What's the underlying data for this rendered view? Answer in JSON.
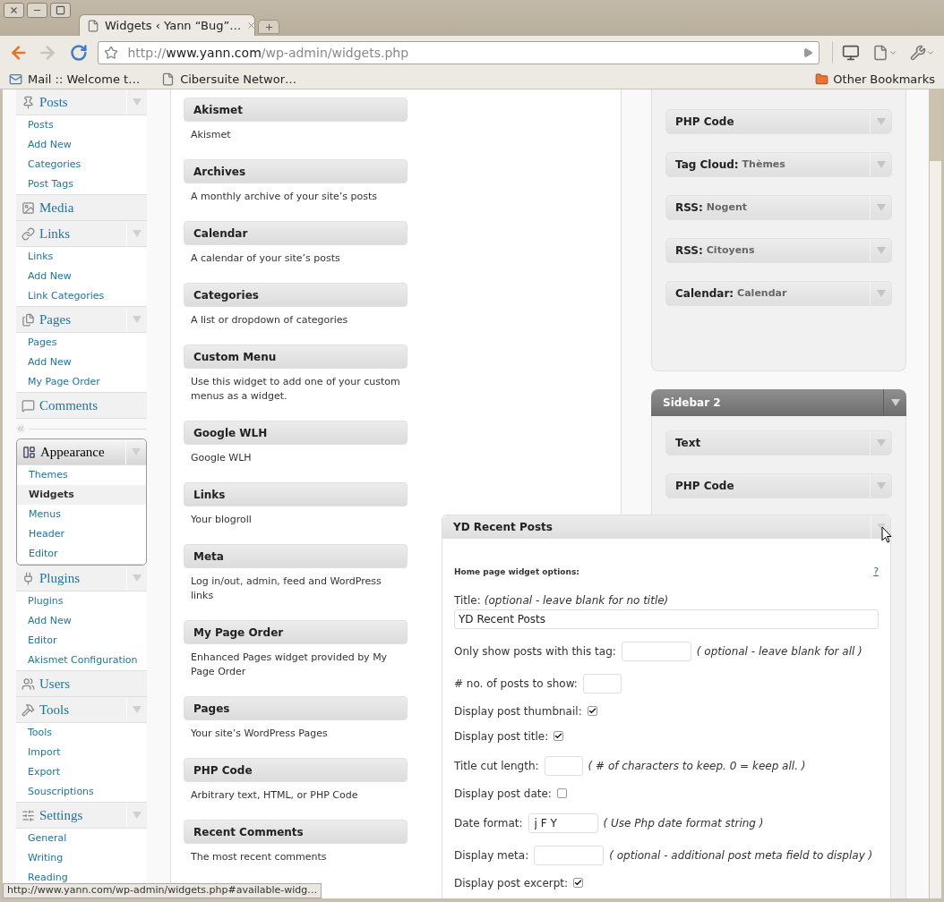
{
  "browser": {
    "tab": {
      "title": "Widgets ‹ Yann “Bug”…",
      "selected": true
    },
    "address": {
      "scheme": "http://",
      "host": "www.yann.com",
      "path": "/wp-admin/widgets.php"
    },
    "bookmarks": [
      {
        "label": "Mail :: Welcome t…",
        "kind": "mail"
      },
      {
        "label": "Cibersuite Networ…",
        "kind": "page"
      }
    ],
    "other_bookmarks": "Other Bookmarks",
    "status_url": "http://www.yann.com/wp-admin/widgets.php#available-widg…"
  },
  "admin_menu": [
    {
      "label": "Posts",
      "expandable": true,
      "selected": false,
      "items": [
        {
          "label": "Posts",
          "selected": false
        },
        {
          "label": "Add New",
          "selected": false
        },
        {
          "label": "Categories",
          "selected": false
        },
        {
          "label": "Post Tags",
          "selected": false
        }
      ]
    },
    {
      "label": "Media",
      "expandable": false,
      "selected": false
    },
    {
      "label": "Links",
      "expandable": true,
      "selected": false,
      "items": [
        {
          "label": "Links",
          "selected": false
        },
        {
          "label": "Add New",
          "selected": false
        },
        {
          "label": "Link Categories",
          "selected": false
        }
      ]
    },
    {
      "label": "Pages",
      "expandable": true,
      "selected": false,
      "items": [
        {
          "label": "Pages",
          "selected": false
        },
        {
          "label": "Add New",
          "selected": false
        },
        {
          "label": "My Page Order",
          "selected": false
        }
      ]
    },
    {
      "label": "Comments",
      "expandable": false,
      "selected": false
    },
    {
      "label": "Appearance",
      "expandable": true,
      "selected": true,
      "items": [
        {
          "label": "Themes",
          "selected": false
        },
        {
          "label": "Widgets",
          "selected": true
        },
        {
          "label": "Menus",
          "selected": false
        },
        {
          "label": "Header",
          "selected": false
        },
        {
          "label": "Editor",
          "selected": false
        }
      ]
    },
    {
      "label": "Plugins",
      "expandable": true,
      "selected": false,
      "items": [
        {
          "label": "Plugins",
          "selected": false
        },
        {
          "label": "Add New",
          "selected": false
        },
        {
          "label": "Editor",
          "selected": false
        },
        {
          "label": "Akismet Configuration",
          "selected": false
        }
      ]
    },
    {
      "label": "Users",
      "expandable": false,
      "selected": false
    },
    {
      "label": "Tools",
      "expandable": true,
      "selected": false,
      "items": [
        {
          "label": "Tools",
          "selected": false
        },
        {
          "label": "Import",
          "selected": false
        },
        {
          "label": "Export",
          "selected": false
        },
        {
          "label": "Souscriptions",
          "selected": false
        }
      ]
    },
    {
      "label": "Settings",
      "expandable": true,
      "selected": false,
      "items": [
        {
          "label": "General",
          "selected": false
        },
        {
          "label": "Writing",
          "selected": false
        },
        {
          "label": "Reading",
          "selected": false
        }
      ]
    }
  ],
  "available_widgets": [
    {
      "name": "Akismet",
      "description": "Akismet"
    },
    {
      "name": "Archives",
      "description": "A monthly archive of your site’s posts"
    },
    {
      "name": "Calendar",
      "description": "A calendar of your site’s posts"
    },
    {
      "name": "Categories",
      "description": "A list or dropdown of categories"
    },
    {
      "name": "Custom Menu",
      "description": "Use this widget to add one of your custom menus as a widget."
    },
    {
      "name": "Google WLH",
      "description": "Google WLH"
    },
    {
      "name": "Links",
      "description": "Your blogroll"
    },
    {
      "name": "Meta",
      "description": "Log in/out, admin, feed and WordPress links"
    },
    {
      "name": "My Page Order",
      "description": "Enhanced Pages widget provided by My Page Order"
    },
    {
      "name": "Pages",
      "description": "Your site’s WordPress Pages"
    },
    {
      "name": "PHP Code",
      "description": "Arbitrary text, HTML, or PHP Code"
    },
    {
      "name": "Recent Comments",
      "description": "The most recent comments"
    }
  ],
  "sidebar_1": {
    "widgets": [
      {
        "name": "PHP Code"
      },
      {
        "name": "Tag Cloud:",
        "detail": "Thèmes"
      },
      {
        "name": "RSS:",
        "detail": "Nogent"
      },
      {
        "name": "RSS:",
        "detail": "Citoyens"
      },
      {
        "name": "Calendar:",
        "detail": "Calendar"
      }
    ]
  },
  "sidebar_2": {
    "title": "Sidebar 2",
    "widgets": [
      {
        "name": "Text"
      },
      {
        "name": "PHP Code"
      }
    ]
  },
  "dragged_widget": {
    "title": "YD Recent Posts",
    "section_heading": "Home page widget options:",
    "help_link": "?",
    "fields": [
      {
        "kind": "wide",
        "label": "Title:",
        "hint": "(optional - leave blank for no title)",
        "value": "YD Recent Posts"
      },
      {
        "kind": "input",
        "label": "Only show posts with this tag:",
        "hint": "( optional - leave blank for all )"
      },
      {
        "kind": "short-input",
        "label": "# no. of posts to show:"
      },
      {
        "kind": "checkbox",
        "label": "Display post thumbnail:",
        "checked": true
      },
      {
        "kind": "checkbox",
        "label": "Display post title:",
        "checked": true
      },
      {
        "kind": "short-input",
        "label": "Title cut length:",
        "hint": "( # of characters to keep. 0 = keep all. )"
      },
      {
        "kind": "checkbox",
        "label": "Display post date:",
        "checked": false
      },
      {
        "kind": "input",
        "label": "Date format:",
        "hint": "( Use Php date format string )",
        "value": "j F Y"
      },
      {
        "kind": "input",
        "label": "Display meta:",
        "hint": "( optional - additional post meta field to display )"
      },
      {
        "kind": "checkbox",
        "label": "Display post excerpt:",
        "checked": true
      }
    ]
  }
}
